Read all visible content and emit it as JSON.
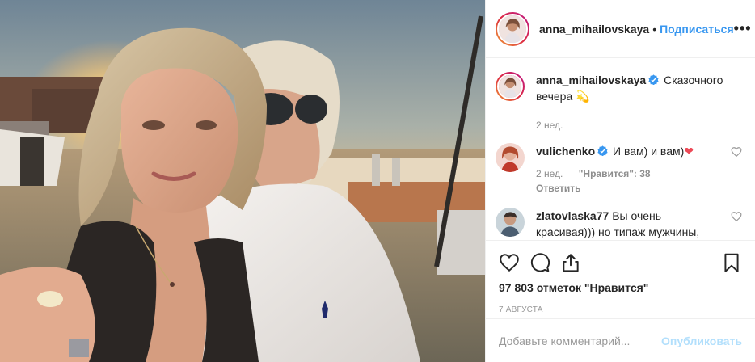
{
  "header": {
    "username": "anna_mihailovskaya",
    "separator": "•",
    "follow_label": "Подписаться",
    "more_label": "•••"
  },
  "caption": {
    "username": "anna_mihailovskaya",
    "text": "Сказочного вечера",
    "emoji": "💫",
    "time": "2 нед."
  },
  "comments": [
    {
      "username": "vulichenko",
      "verified": true,
      "text": "И вам) и вам)",
      "emoji": "❤",
      "time": "2 нед.",
      "likes": "\"Нравится\": 38",
      "reply": "Ответить"
    },
    {
      "username": "zlatovlaska77",
      "verified": false,
      "text": "Вы очень красивая))) но типаж мужчины,"
    }
  ],
  "actions": {
    "like_icon": "heart-icon",
    "comment_icon": "comment-icon",
    "share_icon": "share-icon",
    "save_icon": "bookmark-icon"
  },
  "likes_text": "97 803 отметок \"Нравится\"",
  "date_text": "7 августа",
  "add_comment": {
    "placeholder": "Добавьте комментарий...",
    "post_label": "Опубликовать"
  },
  "colors": {
    "link_blue": "#3897f0",
    "post_disabled": "#b2dffc",
    "verified_blue": "#3897f0",
    "heart_red": "#ed4956"
  }
}
